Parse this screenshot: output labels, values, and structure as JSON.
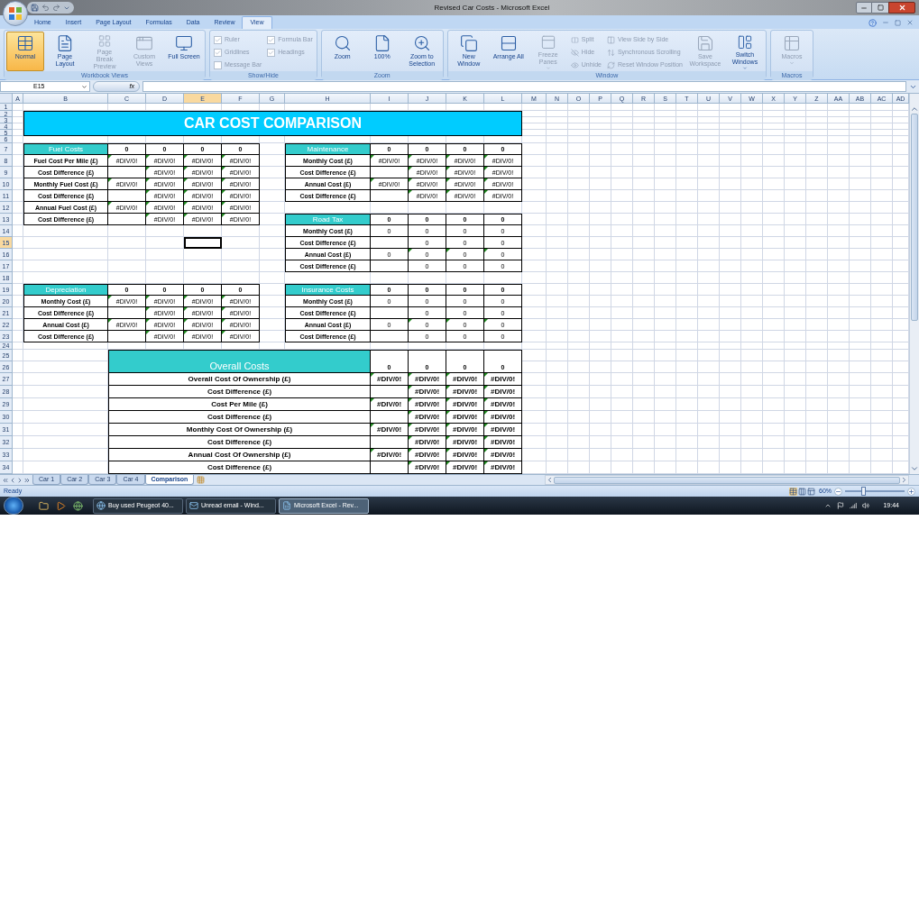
{
  "window": {
    "title": "Revised Car Costs - Microsoft Excel"
  },
  "ribbon_tabs": [
    {
      "label": "Home",
      "selected": false
    },
    {
      "label": "Insert",
      "selected": false
    },
    {
      "label": "Page Layout",
      "selected": false
    },
    {
      "label": "Formulas",
      "selected": false
    },
    {
      "label": "Data",
      "selected": false
    },
    {
      "label": "Review",
      "selected": false
    },
    {
      "label": "View",
      "selected": true
    }
  ],
  "ribbon_groups": [
    {
      "label": "Workbook Views",
      "controls": [
        {
          "kind": "large",
          "label": "Normal",
          "selected": true,
          "disabled": false
        },
        {
          "kind": "large",
          "label": "Page Layout",
          "selected": false,
          "disabled": false
        },
        {
          "kind": "large",
          "label": "Page Break Preview",
          "selected": false,
          "disabled": true
        },
        {
          "kind": "large",
          "label": "Custom Views",
          "selected": false,
          "disabled": true
        },
        {
          "kind": "large",
          "label": "Full Screen",
          "selected": false,
          "disabled": false
        }
      ]
    },
    {
      "label": "Show/Hide",
      "controls": [
        {
          "kind": "check",
          "label": "Ruler",
          "checked": true,
          "disabled": true
        },
        {
          "kind": "check",
          "label": "Gridlines",
          "checked": true,
          "disabled": true
        },
        {
          "kind": "check",
          "label": "Message Bar",
          "checked": false,
          "disabled": true
        },
        {
          "kind": "check",
          "label": "Formula Bar",
          "checked": true,
          "disabled": true
        },
        {
          "kind": "check",
          "label": "Headings",
          "checked": true,
          "disabled": true
        }
      ]
    },
    {
      "label": "Zoom",
      "controls": [
        {
          "kind": "large",
          "label": "Zoom",
          "disabled": false
        },
        {
          "kind": "large",
          "label": "100%",
          "disabled": false
        },
        {
          "kind": "large",
          "label": "Zoom to Selection",
          "disabled": false
        }
      ]
    },
    {
      "label": "Window",
      "controls": [
        {
          "kind": "large",
          "label": "New Window",
          "disabled": false
        },
        {
          "kind": "large",
          "label": "Arrange All",
          "disabled": false
        },
        {
          "kind": "large",
          "label": "Freeze Panes",
          "disabled": true,
          "dropdown": true
        },
        {
          "kind": "small",
          "label": "Split",
          "disabled": true
        },
        {
          "kind": "small",
          "label": "Hide",
          "disabled": true
        },
        {
          "kind": "small",
          "label": "Unhide",
          "disabled": true
        },
        {
          "kind": "small",
          "label": "View Side by Side",
          "disabled": true
        },
        {
          "kind": "small",
          "label": "Synchronous Scrolling",
          "disabled": true
        },
        {
          "kind": "small",
          "label": "Reset Window Position",
          "disabled": true
        },
        {
          "kind": "large",
          "label": "Save Workspace",
          "disabled": true
        },
        {
          "kind": "large",
          "label": "Switch Windows",
          "disabled": false,
          "dropdown": true
        }
      ]
    },
    {
      "label": "Macros",
      "controls": [
        {
          "kind": "large",
          "label": "Macros",
          "disabled": true,
          "dropdown": true
        }
      ]
    }
  ],
  "formula_bar": {
    "name_box": "E15",
    "function_label": "fx"
  },
  "column_headers": [
    {
      "label": "A",
      "selected": false
    },
    {
      "label": "B",
      "selected": false
    },
    {
      "label": "C",
      "selected": false
    },
    {
      "label": "D",
      "selected": false
    },
    {
      "label": "E",
      "selected": true
    },
    {
      "label": "F",
      "selected": false
    },
    {
      "label": "G",
      "selected": false
    },
    {
      "label": "H",
      "selected": false
    },
    {
      "label": "I",
      "selected": false
    },
    {
      "label": "J",
      "selected": false
    },
    {
      "label": "K",
      "selected": false
    },
    {
      "label": "L",
      "selected": false
    },
    {
      "label": "M",
      "selected": false
    },
    {
      "label": "N",
      "selected": false
    },
    {
      "label": "O",
      "selected": false
    },
    {
      "label": "P",
      "selected": false
    },
    {
      "label": "Q",
      "selected": false
    },
    {
      "label": "R",
      "selected": false
    },
    {
      "label": "S",
      "selected": false
    },
    {
      "label": "T",
      "selected": false
    },
    {
      "label": "U",
      "selected": false
    },
    {
      "label": "V",
      "selected": false
    },
    {
      "label": "W",
      "selected": false
    },
    {
      "label": "X",
      "selected": false
    },
    {
      "label": "Y",
      "selected": false
    },
    {
      "label": "Z",
      "selected": false
    },
    {
      "label": "AA",
      "selected": false
    },
    {
      "label": "AB",
      "selected": false
    },
    {
      "label": "AC",
      "selected": false
    },
    {
      "label": "AD",
      "selected": false
    }
  ],
  "row_headers": [
    {
      "label": "1",
      "selected": false
    },
    {
      "label": "2",
      "selected": false
    },
    {
      "label": "3",
      "selected": false
    },
    {
      "label": "4",
      "selected": false
    },
    {
      "label": "5",
      "selected": false
    },
    {
      "label": "6",
      "selected": false
    },
    {
      "label": "7",
      "selected": false
    },
    {
      "label": "8",
      "selected": false
    },
    {
      "label": "9",
      "selected": false
    },
    {
      "label": "10",
      "selected": false
    },
    {
      "label": "11",
      "selected": false
    },
    {
      "label": "12",
      "selected": false
    },
    {
      "label": "13",
      "selected": false
    },
    {
      "label": "14",
      "selected": false
    },
    {
      "label": "15",
      "selected": true
    },
    {
      "label": "16",
      "selected": false
    },
    {
      "label": "17",
      "selected": false
    },
    {
      "label": "18",
      "selected": false
    },
    {
      "label": "19",
      "selected": false
    },
    {
      "label": "20",
      "selected": false
    },
    {
      "label": "21",
      "selected": false
    },
    {
      "label": "22",
      "selected": false
    },
    {
      "label": "23",
      "selected": false
    },
    {
      "label": "24",
      "selected": false
    },
    {
      "label": "25",
      "selected": false
    },
    {
      "label": "26",
      "selected": false
    },
    {
      "label": "27",
      "selected": false
    },
    {
      "label": "28",
      "selected": false
    },
    {
      "label": "29",
      "selected": false
    },
    {
      "label": "30",
      "selected": false
    },
    {
      "label": "31",
      "selected": false
    },
    {
      "label": "32",
      "selected": false
    },
    {
      "label": "33",
      "selected": false
    },
    {
      "label": "34",
      "selected": false
    }
  ],
  "sheet": {
    "title": "CAR COST COMPARISON",
    "sections": [
      {
        "title": "Fuel Costs",
        "header_values": [
          "0",
          "0",
          "0",
          "0"
        ],
        "rows": [
          {
            "label": "Fuel Cost Per Mile (£)",
            "cells": [
              {
                "value": "#DIV/0!",
                "flagged": true
              },
              {
                "value": "#DIV/0!",
                "flagged": true
              },
              {
                "value": "#DIV/0!",
                "flagged": true
              },
              {
                "value": "#DIV/0!",
                "flagged": true
              }
            ]
          },
          {
            "label": "Cost Difference (£)",
            "cells": [
              {
                "flagged": false
              },
              {
                "value": "#DIV/0!",
                "flagged": true
              },
              {
                "value": "#DIV/0!",
                "flagged": true
              },
              {
                "value": "#DIV/0!",
                "flagged": true
              }
            ]
          },
          {
            "label": "Monthly Fuel Cost (£)",
            "cells": [
              {
                "value": "#DIV/0!",
                "flagged": true
              },
              {
                "value": "#DIV/0!",
                "flagged": true
              },
              {
                "value": "#DIV/0!",
                "flagged": true
              },
              {
                "value": "#DIV/0!",
                "flagged": true
              }
            ]
          },
          {
            "label": "Cost Difference (£)",
            "cells": [
              {
                "flagged": false
              },
              {
                "value": "#DIV/0!",
                "flagged": true
              },
              {
                "value": "#DIV/0!",
                "flagged": true
              },
              {
                "value": "#DIV/0!",
                "flagged": true
              }
            ]
          },
          {
            "label": "Annual Fuel Cost (£)",
            "cells": [
              {
                "value": "#DIV/0!",
                "flagged": true
              },
              {
                "value": "#DIV/0!",
                "flagged": true
              },
              {
                "value": "#DIV/0!",
                "flagged": true
              },
              {
                "value": "#DIV/0!",
                "flagged": true
              }
            ]
          },
          {
            "label": "Cost Difference (£)",
            "cells": [
              {
                "flagged": false
              },
              {
                "value": "#DIV/0!",
                "flagged": true
              },
              {
                "value": "#DIV/0!",
                "flagged": true
              },
              {
                "value": "#DIV/0!",
                "flagged": true
              }
            ]
          }
        ]
      },
      {
        "title": "Maintenance",
        "header_values": [
          "0",
          "0",
          "0",
          "0"
        ],
        "rows": [
          {
            "label": "Monthly Cost (£)",
            "cells": [
              {
                "value": "#DIV/0!",
                "flagged": true
              },
              {
                "value": "#DIV/0!",
                "flagged": true
              },
              {
                "value": "#DIV/0!",
                "flagged": true
              },
              {
                "value": "#DIV/0!",
                "flagged": true
              }
            ]
          },
          {
            "label": "Cost Difference (£)",
            "cells": [
              {
                "flagged": false
              },
              {
                "value": "#DIV/0!",
                "flagged": true
              },
              {
                "value": "#DIV/0!",
                "flagged": true
              },
              {
                "value": "#DIV/0!",
                "flagged": true
              }
            ]
          },
          {
            "label": "Annual Cost (£)",
            "cells": [
              {
                "value": "#DIV/0!",
                "flagged": true
              },
              {
                "value": "#DIV/0!",
                "flagged": true
              },
              {
                "value": "#DIV/0!",
                "flagged": true
              },
              {
                "value": "#DIV/0!",
                "flagged": true
              }
            ]
          },
          {
            "label": "Cost Difference (£)",
            "cells": [
              {
                "flagged": false
              },
              {
                "value": "#DIV/0!",
                "flagged": true
              },
              {
                "value": "#DIV/0!",
                "flagged": true
              },
              {
                "value": "#DIV/0!",
                "flagged": true
              }
            ]
          }
        ]
      },
      {
        "title": "Road Tax",
        "header_values": [
          "0",
          "0",
          "0",
          "0"
        ],
        "rows": [
          {
            "label": "Monthly Cost (£)",
            "cells": [
              {
                "value": "0",
                "flagged": false
              },
              {
                "value": "0",
                "flagged": false
              },
              {
                "value": "0",
                "flagged": false
              },
              {
                "value": "0",
                "flagged": false
              }
            ]
          },
          {
            "label": "Cost Difference (£)",
            "cells": [
              {
                "flagged": false
              },
              {
                "value": "0",
                "flagged": false
              },
              {
                "value": "0",
                "flagged": false
              },
              {
                "value": "0",
                "flagged": false
              }
            ]
          },
          {
            "label": "Annual Cost (£)",
            "cells": [
              {
                "value": "0",
                "flagged": false
              },
              {
                "value": "0",
                "flagged": true
              },
              {
                "value": "0",
                "flagged": true
              },
              {
                "value": "0",
                "flagged": true
              }
            ]
          },
          {
            "label": "Cost Difference (£)",
            "cells": [
              {
                "flagged": false
              },
              {
                "value": "0",
                "flagged": false
              },
              {
                "value": "0",
                "flagged": false
              },
              {
                "value": "0",
                "flagged": false
              }
            ]
          }
        ]
      },
      {
        "title": "Depreciation",
        "header_values": [
          "0",
          "0",
          "0",
          "0"
        ],
        "rows": [
          {
            "label": "Monthly Cost (£)",
            "cells": [
              {
                "value": "#DIV/0!",
                "flagged": true
              },
              {
                "value": "#DIV/0!",
                "flagged": true
              },
              {
                "value": "#DIV/0!",
                "flagged": true
              },
              {
                "value": "#DIV/0!",
                "flagged": true
              }
            ]
          },
          {
            "label": "Cost Difference (£)",
            "cells": [
              {
                "flagged": false
              },
              {
                "value": "#DIV/0!",
                "flagged": true
              },
              {
                "value": "#DIV/0!",
                "flagged": true
              },
              {
                "value": "#DIV/0!",
                "flagged": true
              }
            ]
          },
          {
            "label": "Annual Cost (£)",
            "cells": [
              {
                "value": "#DIV/0!",
                "flagged": true
              },
              {
                "value": "#DIV/0!",
                "flagged": true
              },
              {
                "value": "#DIV/0!",
                "flagged": true
              },
              {
                "value": "#DIV/0!",
                "flagged": true
              }
            ]
          },
          {
            "label": "Cost Difference (£)",
            "cells": [
              {
                "flagged": false
              },
              {
                "value": "#DIV/0!",
                "flagged": true
              },
              {
                "value": "#DIV/0!",
                "flagged": true
              },
              {
                "value": "#DIV/0!",
                "flagged": true
              }
            ]
          }
        ]
      },
      {
        "title": "Insurance Costs",
        "header_values": [
          "0",
          "0",
          "0",
          "0"
        ],
        "rows": [
          {
            "label": "Monthly Cost (£)",
            "cells": [
              {
                "value": "0",
                "flagged": false
              },
              {
                "value": "0",
                "flagged": false
              },
              {
                "value": "0",
                "flagged": false
              },
              {
                "value": "0",
                "flagged": false
              }
            ]
          },
          {
            "label": "Cost Difference (£)",
            "cells": [
              {
                "flagged": false
              },
              {
                "value": "0",
                "flagged": false
              },
              {
                "value": "0",
                "flagged": false
              },
              {
                "value": "0",
                "flagged": false
              }
            ]
          },
          {
            "label": "Annual Cost (£)",
            "cells": [
              {
                "value": "0",
                "flagged": false
              },
              {
                "value": "0",
                "flagged": true
              },
              {
                "value": "0",
                "flagged": true
              },
              {
                "value": "0",
                "flagged": true
              }
            ]
          },
          {
            "label": "Cost Difference (£)",
            "cells": [
              {
                "flagged": false
              },
              {
                "value": "0",
                "flagged": false
              },
              {
                "value": "0",
                "flagged": false
              },
              {
                "value": "0",
                "flagged": false
              }
            ]
          }
        ]
      }
    ],
    "overall": {
      "title": "Overall Costs",
      "header_values": [
        "0",
        "0",
        "0",
        "0"
      ],
      "rows": [
        {
          "label": "Overall Cost Of Ownership (£)",
          "cells": [
            {
              "value": "#DIV/0!",
              "flagged": true
            },
            {
              "value": "#DIV/0!",
              "flagged": true
            },
            {
              "value": "#DIV/0!",
              "flagged": true
            },
            {
              "value": "#DIV/0!",
              "flagged": true
            }
          ]
        },
        {
          "label": "Cost Difference (£)",
          "cells": [
            {
              "flagged": false
            },
            {
              "value": "#DIV/0!",
              "flagged": true
            },
            {
              "value": "#DIV/0!",
              "flagged": true
            },
            {
              "value": "#DIV/0!",
              "flagged": true
            }
          ]
        },
        {
          "label": "Cost Per Mile (£)",
          "cells": [
            {
              "value": "#DIV/0!",
              "flagged": true
            },
            {
              "value": "#DIV/0!",
              "flagged": true
            },
            {
              "value": "#DIV/0!",
              "flagged": true
            },
            {
              "value": "#DIV/0!",
              "flagged": true
            }
          ]
        },
        {
          "label": "Cost Difference (£)",
          "cells": [
            {
              "flagged": false
            },
            {
              "value": "#DIV/0!",
              "flagged": true
            },
            {
              "value": "#DIV/0!",
              "flagged": true
            },
            {
              "value": "#DIV/0!",
              "flagged": true
            }
          ]
        },
        {
          "label": "Monthly Cost Of Ownership (£)",
          "cells": [
            {
              "value": "#DIV/0!",
              "flagged": true
            },
            {
              "value": "#DIV/0!",
              "flagged": true
            },
            {
              "value": "#DIV/0!",
              "flagged": true
            },
            {
              "value": "#DIV/0!",
              "flagged": true
            }
          ]
        },
        {
          "label": "Cost Difference (£)",
          "cells": [
            {
              "flagged": false
            },
            {
              "value": "#DIV/0!",
              "flagged": true
            },
            {
              "value": "#DIV/0!",
              "flagged": true
            },
            {
              "value": "#DIV/0!",
              "flagged": true
            }
          ]
        },
        {
          "label": "Annual Cost Of Ownership (£)",
          "cells": [
            {
              "value": "#DIV/0!",
              "flagged": true
            },
            {
              "value": "#DIV/0!",
              "flagged": true
            },
            {
              "value": "#DIV/0!",
              "flagged": true
            },
            {
              "value": "#DIV/0!",
              "flagged": true
            }
          ]
        },
        {
          "label": "Cost Difference (£)",
          "cells": [
            {
              "flagged": false
            },
            {
              "value": "#DIV/0!",
              "flagged": true
            },
            {
              "value": "#DIV/0!",
              "flagged": true
            },
            {
              "value": "#DIV/0!",
              "flagged": true
            }
          ]
        }
      ]
    }
  },
  "sheet_tabs": [
    {
      "label": "Car 1",
      "selected": false
    },
    {
      "label": "Car 2",
      "selected": false
    },
    {
      "label": "Car 3",
      "selected": false
    },
    {
      "label": "Car 4",
      "selected": false
    },
    {
      "label": "Comparison",
      "selected": true
    }
  ],
  "status_bar": {
    "status": "Ready",
    "zoom": "60%",
    "zoom_slider": {
      "level": 0.3
    }
  },
  "taskbar": {
    "tasks": [
      {
        "label": "Buy used Peugeot 40...",
        "selected": false
      },
      {
        "label": "Unread email - Wind...",
        "selected": false
      },
      {
        "label": "Microsoft Excel - Rev...",
        "selected": true
      }
    ],
    "clock": "19:44"
  }
}
